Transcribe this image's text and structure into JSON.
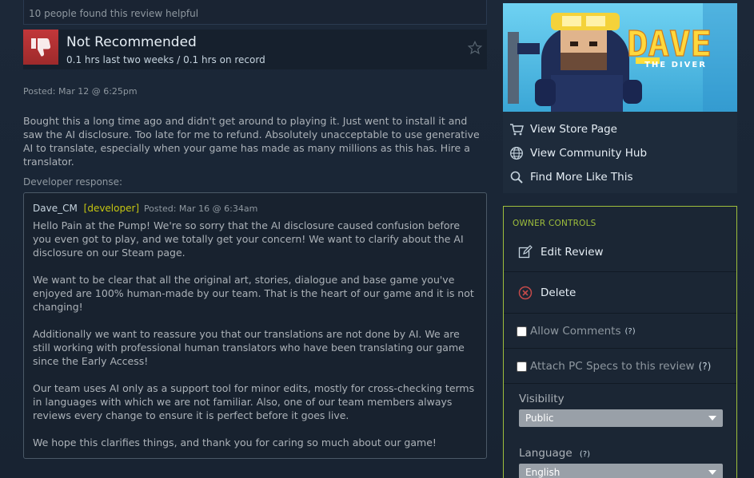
{
  "review": {
    "helpful_text": "10 people found this review helpful",
    "recommendation": "Not Recommended",
    "hours": "0.1 hrs last two weeks / 0.1 hrs on record",
    "posted": "Posted: Mar 12 @ 6:25pm",
    "body": "Bought this a long time ago and didn't get around to playing it. Just went to install it and saw the AI disclosure. Too late for me to refund. Absolutely unacceptable to use generative AI to translate, especially when your game has made as many millions as this has. Hire a translator."
  },
  "developer_response": {
    "label": "Developer response:",
    "author": "Dave_CM",
    "tag": "[developer]",
    "posted": "Posted: Mar 16 @ 6:34am",
    "paragraphs": [
      "Hello Pain at the Pump! We're so sorry that the AI disclosure caused confusion before you even got to play, and we totally get your concern! We want to clarify about the AI disclosure on our Steam page.",
      "We want to be clear that all the original art, stories, dialogue and base game you've enjoyed are 100% human-made by our team. That is the heart of our game and it is not changing!",
      "Additionally we want to reassure you that our translations are not done by AI. We are still working with professional human translators who have been translating our game since the Early Access!",
      "Our team uses AI only as a support tool for minor edits, mostly for cross-checking terms in languages with which we are not familiar. Also, one of our team members always reviews every change to ensure it is perfect before it goes live.",
      "We hope this clarifies things, and thank you for caring so much about our game!"
    ]
  },
  "game": {
    "logo_line1": "DAVE",
    "logo_line2": "THE DIVER",
    "links": [
      "View Store Page",
      "View Community Hub",
      "Find More Like This"
    ]
  },
  "owner_controls": {
    "title": "OWNER CONTROLS",
    "edit": "Edit Review",
    "delete": "Delete",
    "allow_comments": "Allow Comments",
    "attach_specs": "Attach PC Specs to this review",
    "help": "(?)",
    "visibility_label": "Visibility",
    "visibility_value": "Public",
    "language_label": "Language",
    "language_value": "English"
  },
  "colors": {
    "accent_green": "#9fbf3c",
    "developer_tag": "#c5c511",
    "thumbs_down": "#c1373a"
  },
  "icons": [
    "thumbs-down-icon",
    "star-icon",
    "cart-icon",
    "globe-icon",
    "search-icon",
    "edit-icon",
    "delete-icon",
    "caret-down-icon"
  ]
}
